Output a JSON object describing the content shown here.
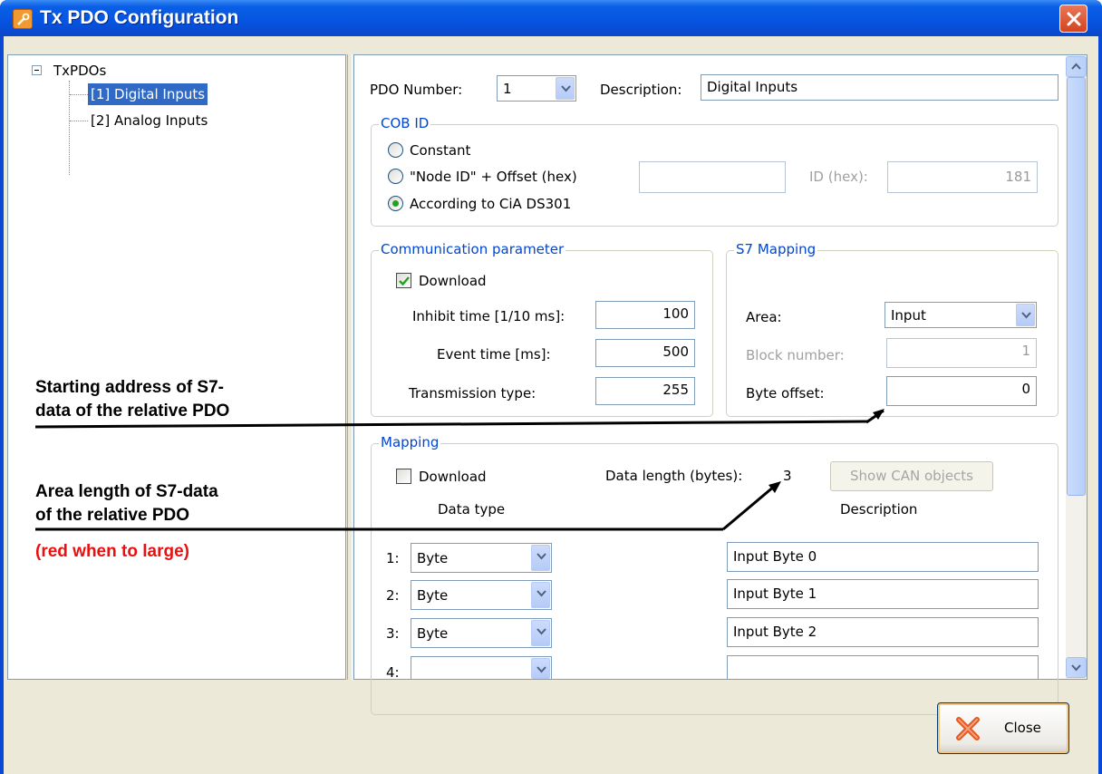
{
  "window": {
    "title": "Tx PDO Configuration"
  },
  "tree": {
    "root": "TxPDOs",
    "items": [
      {
        "label": "[1] Digital Inputs",
        "selected": true
      },
      {
        "label": "[2] Analog Inputs",
        "selected": false
      }
    ]
  },
  "pdo": {
    "number_label": "PDO Number:",
    "number_value": "1",
    "description_label": "Description:",
    "description_value": "Digital Inputs"
  },
  "cob_id": {
    "title": "COB ID",
    "options": [
      {
        "label": "Constant",
        "selected": false
      },
      {
        "label": "\"Node ID\" + Offset (hex)",
        "selected": false
      },
      {
        "label": "According to CiA DS301",
        "selected": true
      }
    ],
    "offset_value": "",
    "id_label": "ID (hex):",
    "id_value": "181"
  },
  "communication": {
    "title": "Communication parameter",
    "download_label": "Download",
    "download_checked": true,
    "inhibit_label": "Inhibit time [1/10 ms]:",
    "inhibit_value": "100",
    "event_label": "Event time [ms]:",
    "event_value": "500",
    "transmission_label": "Transmission type:",
    "transmission_value": "255"
  },
  "s7_mapping": {
    "title": "S7 Mapping",
    "area_label": "Area:",
    "area_value": "Input",
    "block_label": "Block number:",
    "block_value": "1",
    "offset_label": "Byte offset:",
    "offset_value": "0"
  },
  "mapping": {
    "title": "Mapping",
    "download_label": "Download",
    "download_checked": false,
    "data_length_label": "Data length (bytes):",
    "data_length_value": "3",
    "show_can_label": "Show CAN objects",
    "col_data_type": "Data type",
    "col_description": "Description",
    "rows": [
      {
        "num": "1:",
        "type": "Byte",
        "description": "Input Byte 0"
      },
      {
        "num": "2:",
        "type": "Byte",
        "description": "Input Byte 1"
      },
      {
        "num": "3:",
        "type": "Byte",
        "description": "Input Byte 2"
      },
      {
        "num": "4:",
        "type": "",
        "description": ""
      }
    ]
  },
  "annotations": {
    "start_line1": "Starting address of S7-",
    "start_line2": "data of the relative PDO",
    "length_line1": "Area length of S7-data",
    "length_line2": "of the relative PDO",
    "red_note": "(red when to large)"
  },
  "footer": {
    "close_label": "Close"
  },
  "colors": {
    "titlebar": "#0554e0",
    "selection": "#316ac5",
    "group_title": "#0046d5",
    "annotation_red": "#e81010",
    "close_icon": "#e8571b"
  }
}
